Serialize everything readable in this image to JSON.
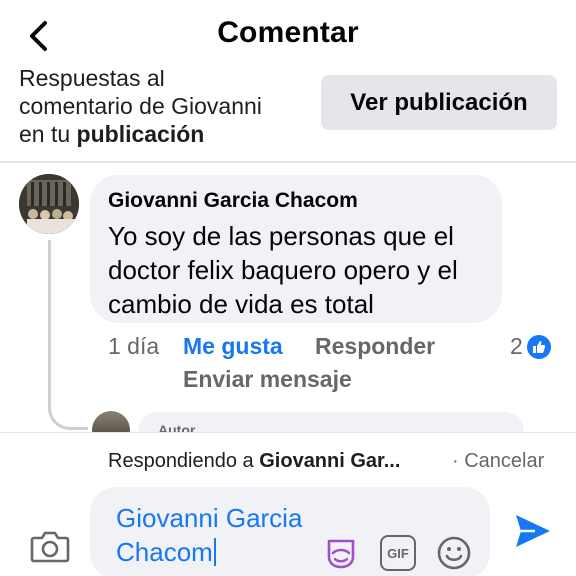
{
  "header": {
    "title": "Comentar",
    "back_icon": "chevron-left-icon"
  },
  "context": {
    "line_partial": "Respuestas al",
    "line2": "comentario de Giovanni",
    "line3_prefix": "en tu ",
    "line3_bold": "publicación",
    "view_post_label": "Ver publicación"
  },
  "comment": {
    "author": "Giovanni Garcia Chacom",
    "text": "Yo soy de las personas que el doctor felix baquero opero y el cambio de vida es total",
    "time": "1 día",
    "like_label": "Me gusta",
    "reply_label": "Responder",
    "message_label": "Enviar mensaje",
    "reaction_count": "2"
  },
  "reply_preview": {
    "tag": "Autor"
  },
  "composer": {
    "replying_prefix": "Respondiendo a ",
    "replying_name": "Giovanni Gar...",
    "separator": " · ",
    "cancel_label": "Cancelar",
    "input_value": "Giovanni Garcia Chacom",
    "gif_label": "GIF"
  },
  "colors": {
    "accent": "#1877f2",
    "bubble": "#f0f2f5",
    "secondary_text": "#65676b",
    "button_bg": "#e4e6eb"
  }
}
